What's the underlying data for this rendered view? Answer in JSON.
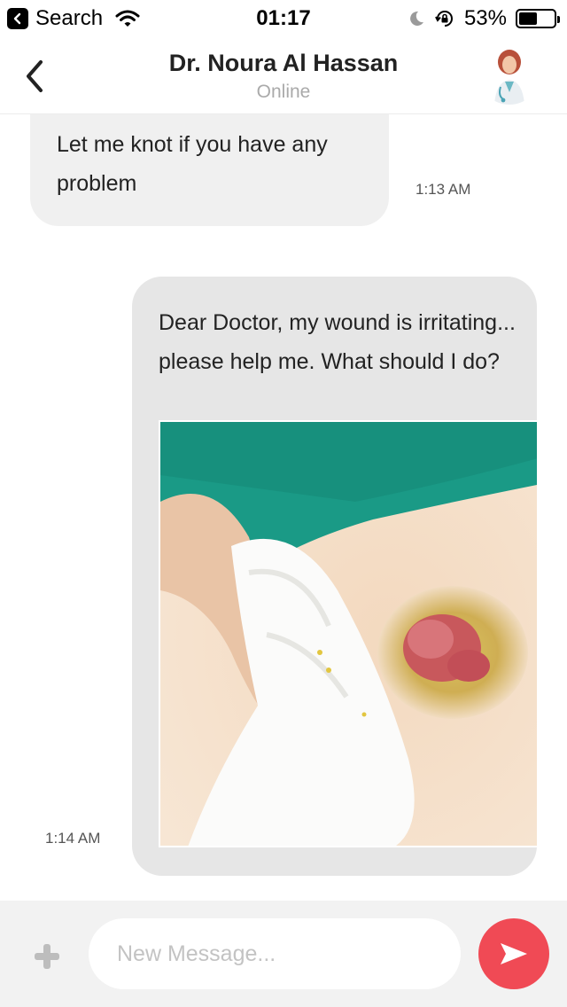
{
  "status_bar": {
    "back_label": "Search",
    "time": "01:17",
    "battery": "53%",
    "battery_level": 0.53
  },
  "header": {
    "title": "Dr. Noura Al Hassan",
    "status": "Online"
  },
  "messages": [
    {
      "direction": "incoming",
      "text": " Let me knot if you have any\nproblem",
      "time": "1:13 AM"
    },
    {
      "direction": "outgoing",
      "text": "Dear Doctor, my wound is irritating... please help me. What should I do?",
      "time": "1:14 AM",
      "attachment": "photo"
    }
  ],
  "composer": {
    "placeholder": "New Message..."
  },
  "colors": {
    "accent": "#f04a55",
    "incoming_bubble": "#f0f0f0",
    "outgoing_bubble": "#e6e6e6",
    "photo_drape": "#1a9a86"
  },
  "icons": {
    "back_app": "chevron-left-icon",
    "wifi": "wifi-icon",
    "moon": "moon-icon",
    "rotation_lock": "rotation-lock-icon",
    "battery": "battery-icon",
    "header_back": "chevron-left-icon",
    "plus": "plus-icon",
    "send": "send-icon"
  }
}
